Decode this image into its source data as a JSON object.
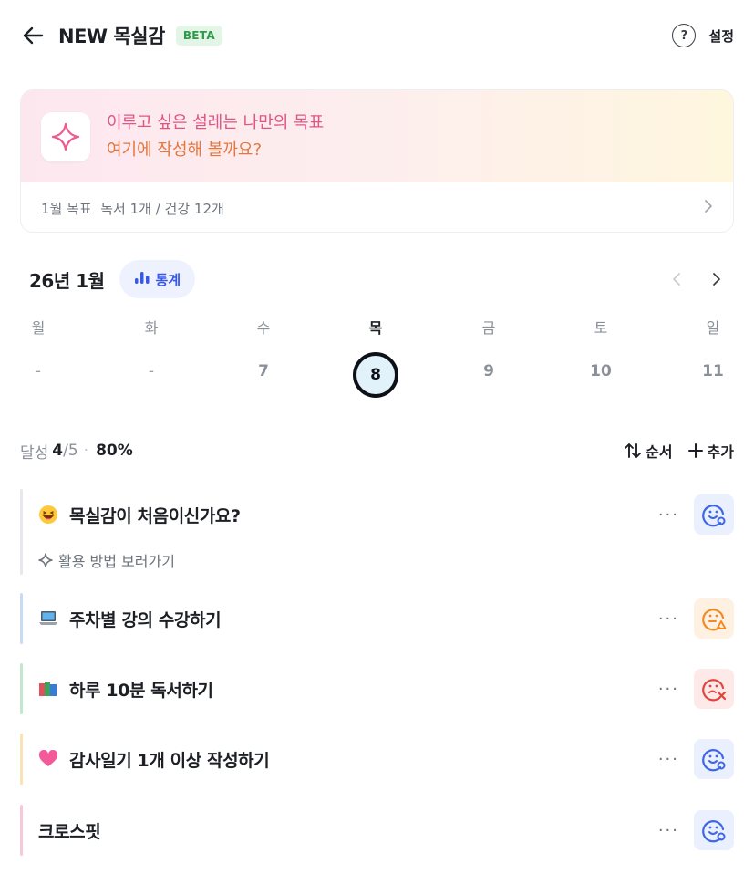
{
  "header": {
    "title": "NEW 목실감",
    "badge": "BETA",
    "help_icon_glyph": "?",
    "settings_label": "설정"
  },
  "goal": {
    "line1": "이루고 싶은 설레는 나만의 목표",
    "line2": "여기에 작성해 볼까요?",
    "summary": "1월 목표  독서 1개 / 건강 12개"
  },
  "calendar": {
    "month_label": "26년 1월",
    "stats_label": "통계",
    "days": [
      {
        "name": "월",
        "num": "-"
      },
      {
        "name": "화",
        "num": "-"
      },
      {
        "name": "수",
        "num": "7"
      },
      {
        "name": "목",
        "num": "8",
        "today": true
      },
      {
        "name": "금",
        "num": "9"
      },
      {
        "name": "토",
        "num": "10"
      },
      {
        "name": "일",
        "num": "11"
      }
    ]
  },
  "summary": {
    "label": "달성",
    "done": "4",
    "total": "/5",
    "dot": "·",
    "percent": "80%",
    "order_label": "순서",
    "add_label": "추가"
  },
  "tasks": [
    {
      "emoji": "grinning-face",
      "title": "목실감이 처음이신가요?",
      "sub": "활용 방법 보러가기",
      "bar_color": "#e6e8eb",
      "status": "happy",
      "status_color": "#3e66e8",
      "status_bg": "#eaf0fd"
    },
    {
      "emoji": "laptop",
      "title": "주차별 강의 수강하기",
      "bar_color": "#c9daf5",
      "status": "warning",
      "status_color": "#f08a24",
      "status_bg": "#fff1e2"
    },
    {
      "emoji": "books",
      "title": "하루 10분 독서하기",
      "bar_color": "#bfe8cf",
      "status": "fail",
      "status_color": "#e0463e",
      "status_bg": "#fde9e8"
    },
    {
      "emoji": "heart",
      "title": "감사일기 1개 이상 작성하기",
      "bar_color": "#f8e2b6",
      "status": "happy",
      "status_color": "#3e66e8",
      "status_bg": "#eaf0fd"
    },
    {
      "emoji": "",
      "title": "크로스핏",
      "bar_color": "#f6c8d9",
      "status": "happy",
      "status_color": "#3e66e8",
      "status_bg": "#eaf0fd"
    }
  ],
  "more_glyph": "···"
}
